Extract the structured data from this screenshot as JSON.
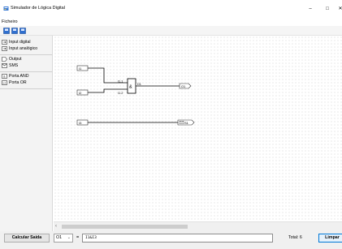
{
  "window": {
    "title": "Simulador de Lógica Digital",
    "minimize": "–",
    "maximize": "□",
    "close": "✕"
  },
  "menu": {
    "file": "Ficheiro"
  },
  "toolbar": {
    "icons": [
      "new-icon",
      "open-icon",
      "save-icon"
    ]
  },
  "sidebar": {
    "inputs": [
      "Input digital",
      "Input analógico"
    ],
    "outputs": [
      "Output",
      "SMS"
    ],
    "gates": [
      "Porta AND",
      "Porta OR"
    ]
  },
  "circuit": {
    "inputs": [
      "I1",
      "I2",
      "I3"
    ],
    "gate_symbol": "&",
    "gate_name": "D1",
    "gate_inputs": [
      "I1.1",
      "I1.2"
    ],
    "outputs": [
      "O1",
      "S1"
    ]
  },
  "bottom": {
    "calculate": "Calcular Saída",
    "selected_output": "O1",
    "equals": "=",
    "expression": "I1&I3",
    "total": "Total: 6",
    "clear": "Limpar"
  },
  "colors": {
    "accent": "#0078d7",
    "wire": "#000000",
    "grid_dot": "#d4d4d4"
  }
}
